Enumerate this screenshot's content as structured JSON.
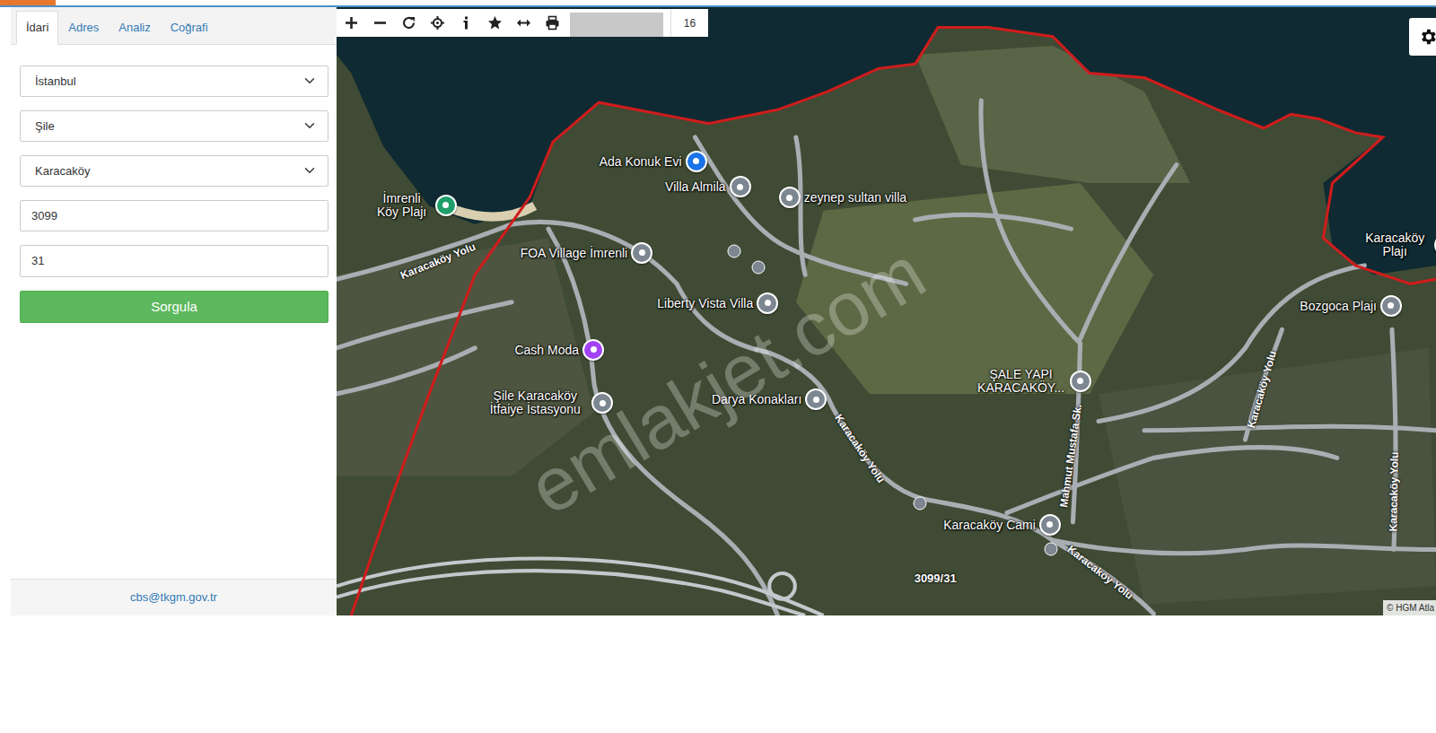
{
  "tabs": [
    {
      "label": "İdari",
      "selected": true
    },
    {
      "label": "Adres",
      "selected": false
    },
    {
      "label": "Analiz",
      "selected": false
    },
    {
      "label": "Coğrafi",
      "selected": false
    }
  ],
  "form": {
    "selects": [
      "İstanbul",
      "Şile",
      "Karacaköy"
    ],
    "inputs": [
      "3099",
      "31"
    ],
    "button": "Sorgula"
  },
  "footer": "cbs@tkgm.gov.tr",
  "toolbar": {
    "zoom": "16"
  },
  "map": {
    "places": [
      {
        "label": "İmrenli Köy Plajı",
        "color": "#1e9e6a"
      },
      {
        "label": "Ada Konuk Evi",
        "color": "#1a73e8"
      },
      {
        "label": "Villa Almila",
        "color": "#7d8791"
      },
      {
        "label": "zeynep sultan villa",
        "color": "#7d8791"
      },
      {
        "label": "FOA Village İmrenli",
        "color": "#7d8791"
      },
      {
        "label": "Liberty Vista Villa",
        "color": "#7d8791"
      },
      {
        "label": "Cash Moda",
        "color": "#a142f4"
      },
      {
        "label": "Şile Karacaköy İtfaiye İstasyonu",
        "color": "#7d8791"
      },
      {
        "label": "Darya Konakları",
        "color": "#7d8791"
      },
      {
        "label": "ŞALE YAPI KARACAKÖY...",
        "color": "#7d8791"
      },
      {
        "label": "Karacaköy Cami",
        "color": "#7d8791"
      },
      {
        "label": "Bozgoca Plajı",
        "color": "#7d8791"
      },
      {
        "label": "Karacaköy Plajı",
        "color": "#1e9e6a"
      }
    ],
    "roads": [
      "Karacaköy Yolu",
      "Karacaköy Yolu",
      "Mahmut Mustafa Sk.",
      "Karacaköy Yolu",
      "Karacaköy Yolu",
      "Karacaköy Yolu"
    ],
    "parcel": "3099/31",
    "watermark": "emlakjet.com",
    "attribution": "© HGM Atla"
  }
}
